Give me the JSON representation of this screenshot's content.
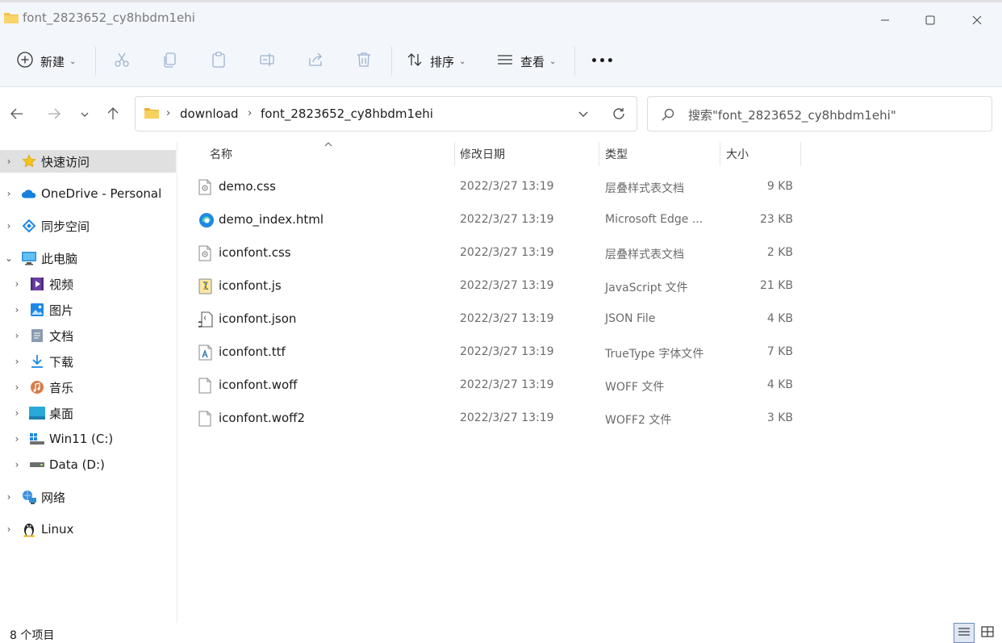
{
  "window": {
    "title": "font_2823652_cy8hbdm1ehi"
  },
  "toolbar": {
    "new_label": "新建",
    "sort_label": "排序",
    "view_label": "查看",
    "more_label": "•••"
  },
  "address": {
    "crumbs": [
      "download",
      "font_2823652_cy8hbdm1ehi"
    ]
  },
  "search": {
    "placeholder": "搜索\"font_2823652_cy8hbdm1ehi\""
  },
  "sidebar": {
    "items": [
      {
        "label": "快速访问",
        "icon": "star-icon"
      },
      {
        "label": "OneDrive - Personal",
        "icon": "onedrive-cloud-icon"
      },
      {
        "label": "同步空间",
        "icon": "sync-space-icon"
      },
      {
        "label": "此电脑",
        "icon": "this-pc-icon"
      },
      {
        "label": "视频",
        "icon": "video-icon"
      },
      {
        "label": "图片",
        "icon": "pictures-icon"
      },
      {
        "label": "文档",
        "icon": "documents-icon"
      },
      {
        "label": "下载",
        "icon": "downloads-icon"
      },
      {
        "label": "音乐",
        "icon": "music-icon"
      },
      {
        "label": "桌面",
        "icon": "desktop-icon"
      },
      {
        "label": "Win11 (C:)",
        "icon": "drive-c-icon"
      },
      {
        "label": "Data (D:)",
        "icon": "drive-d-icon"
      },
      {
        "label": "网络",
        "icon": "network-icon"
      },
      {
        "label": "Linux",
        "icon": "linux-tux-icon"
      }
    ]
  },
  "columns": {
    "name": "名称",
    "modified": "修改日期",
    "type": "类型",
    "size": "大小"
  },
  "files": [
    {
      "name": "demo.css",
      "modified": "2022/3/27 13:19",
      "type": "层叠样式表文档",
      "size": "9 KB",
      "icon": "css-file-icon"
    },
    {
      "name": "demo_index.html",
      "modified": "2022/3/27 13:19",
      "type": "Microsoft Edge ...",
      "size": "23 KB",
      "icon": "edge-html-icon"
    },
    {
      "name": "iconfont.css",
      "modified": "2022/3/27 13:19",
      "type": "层叠样式表文档",
      "size": "2 KB",
      "icon": "css-file-icon"
    },
    {
      "name": "iconfont.js",
      "modified": "2022/3/27 13:19",
      "type": "JavaScript 文件",
      "size": "21 KB",
      "icon": "js-file-icon"
    },
    {
      "name": "iconfont.json",
      "modified": "2022/3/27 13:19",
      "type": "JSON File",
      "size": "4 KB",
      "icon": "json-file-icon"
    },
    {
      "name": "iconfont.ttf",
      "modified": "2022/3/27 13:19",
      "type": "TrueType 字体文件",
      "size": "7 KB",
      "icon": "font-file-icon"
    },
    {
      "name": "iconfont.woff",
      "modified": "2022/3/27 13:19",
      "type": "WOFF 文件",
      "size": "4 KB",
      "icon": "blank-file-icon"
    },
    {
      "name": "iconfont.woff2",
      "modified": "2022/3/27 13:19",
      "type": "WOFF2 文件",
      "size": "3 KB",
      "icon": "blank-file-icon"
    }
  ],
  "status": {
    "count_text": "8 个项目"
  }
}
